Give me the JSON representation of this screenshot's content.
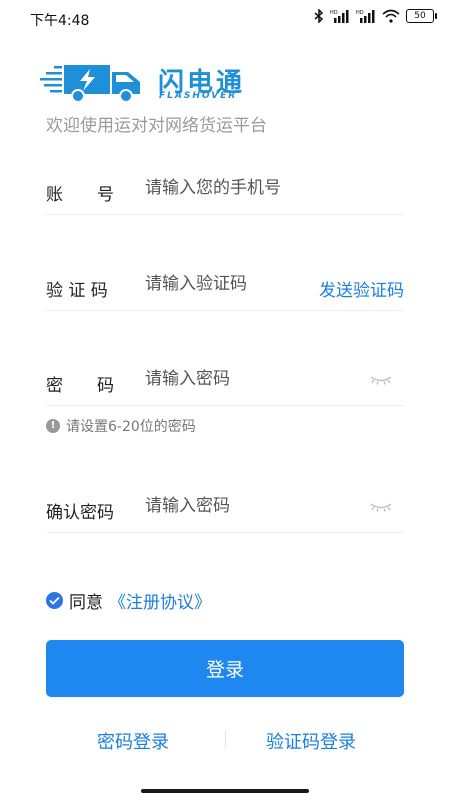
{
  "status": {
    "time": "下午4:48",
    "battery": "50",
    "icons": [
      "bluetooth-icon",
      "hd-signal-icon",
      "hd-signal-icon",
      "wifi-icon",
      "battery-icon"
    ]
  },
  "brand": {
    "name_cn": "闪电通",
    "name_en": "FLASHOVER",
    "slogan": "欢迎使用运对对网络货运平台",
    "color": "#1f8fd8"
  },
  "form": {
    "account": {
      "label": "账　　号",
      "placeholder": "请输入您的手机号"
    },
    "code": {
      "label": "验 证 码",
      "placeholder": "请输入验证码",
      "action": "发送验证码"
    },
    "password": {
      "label": "密　　码",
      "placeholder": "请输入密码",
      "hint": "请设置6-20位的密码"
    },
    "confirm": {
      "label": "确认密码",
      "placeholder": "请输入密码"
    }
  },
  "agreement": {
    "text": "同意",
    "link": "《注册协议》",
    "checked": true
  },
  "login_button": "登录",
  "alt_login": {
    "password": "密码登录",
    "code": "验证码登录"
  },
  "colors": {
    "accent": "#1e88f0",
    "link": "#1a7fe0"
  }
}
